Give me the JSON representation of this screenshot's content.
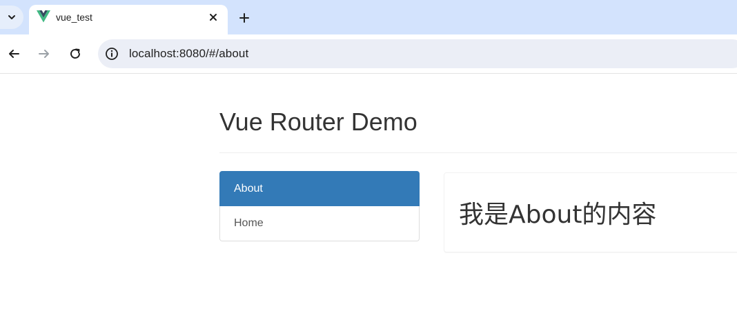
{
  "browser": {
    "tab": {
      "title": "vue_test",
      "favicon_icon": "vue-logo-icon"
    },
    "url": "localhost:8080/#/about",
    "colors": {
      "tabstrip": "#d3e3fd",
      "omnibox": "#ebeef6"
    }
  },
  "page": {
    "title": "Vue Router Demo",
    "nav": {
      "items": [
        {
          "label": "About",
          "active": true
        },
        {
          "label": "Home",
          "active": false
        }
      ]
    },
    "content": {
      "heading": "我是About的内容"
    },
    "colors": {
      "active_item": "#337ab7",
      "text": "#333333"
    }
  }
}
